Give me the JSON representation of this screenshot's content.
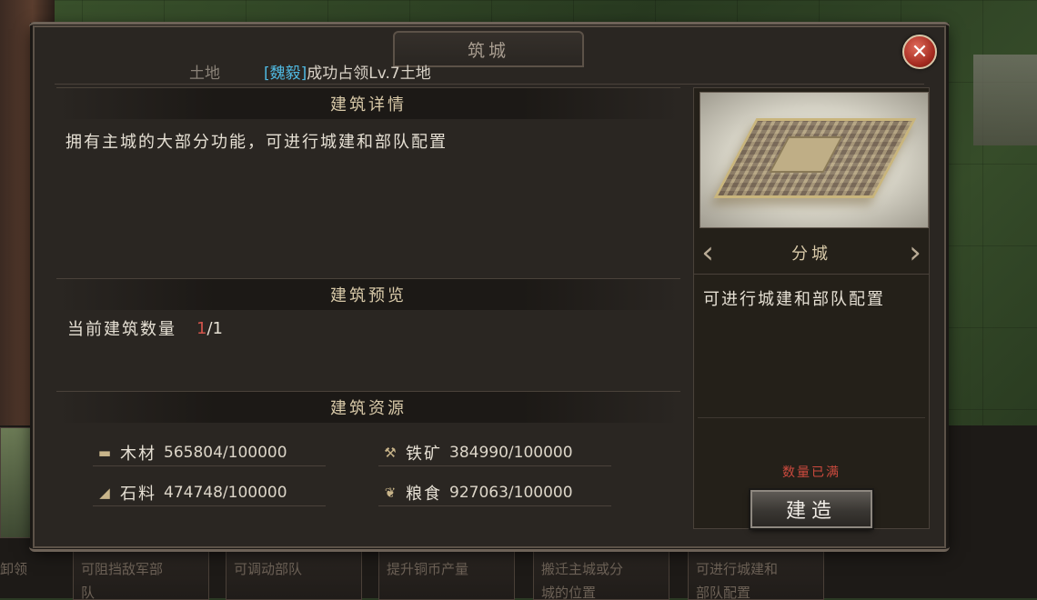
{
  "dialog": {
    "title": "筑城",
    "close_label": "✕"
  },
  "ticker": {
    "prefix": "土地",
    "alliance": "[魏毅]",
    "message": "成功占领Lv.7土地"
  },
  "sections": {
    "detail": {
      "header": "建筑详情",
      "text": "拥有主城的大部分功能，可进行城建和部队配置"
    },
    "preview": {
      "header": "建筑预览",
      "count_label": "当前建筑数量",
      "count_current": "1",
      "count_total": "/1"
    },
    "resources": {
      "header": "建筑资源",
      "items": [
        {
          "icon": "wood-icon",
          "name": "木材",
          "amount": "565804/100000"
        },
        {
          "icon": "iron-icon",
          "name": "铁矿",
          "amount": "384990/100000"
        },
        {
          "icon": "stone-icon",
          "name": "石料",
          "amount": "474748/100000"
        },
        {
          "icon": "grain-icon",
          "name": "粮食",
          "amount": "927063/100000"
        }
      ]
    }
  },
  "right_panel": {
    "building_name": "分城",
    "description": "可进行城建和部队配置",
    "status": "数量已满",
    "build_button": "建造",
    "prev_arrow": "‹",
    "next_arrow": "›"
  },
  "background": {
    "cards": [
      "可阻挡敌军部\n队",
      "可调动部队",
      "提升铜币产量",
      "搬迁主城或分\n城的位置",
      "可进行城建和\n部队配置"
    ],
    "left_card": "卸领"
  },
  "colors": {
    "accent_alliance": "#4fb8e0",
    "status_red": "#cc4a3e",
    "header_gold": "#d8c9a8"
  }
}
